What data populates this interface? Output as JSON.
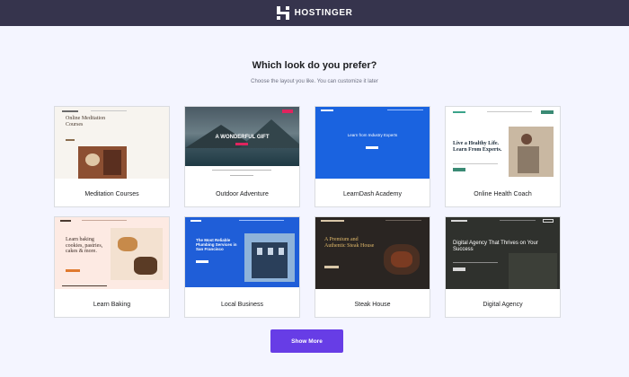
{
  "brand": {
    "name": "HOSTINGER"
  },
  "page": {
    "title": "Which look do you prefer?",
    "subtitle": "Choose the layout you like. You can customize it later"
  },
  "templates": [
    {
      "label": "Meditation Courses",
      "hero": "Online Meditation Courses"
    },
    {
      "label": "Outdoor Adventure",
      "hero": "A WONDERFUL GIFT"
    },
    {
      "label": "LearnDash Academy",
      "hero": "Learn from Industry Experts"
    },
    {
      "label": "Online Health Coach",
      "hero": "Live a Healthy Life. Learn From Experts."
    },
    {
      "label": "Learn Baking",
      "hero": "Learn baking cookies, pastries, cakes & more."
    },
    {
      "label": "Local Business",
      "hero": "The Most Reliable Plumbing Services in San Francisco"
    },
    {
      "label": "Steak House",
      "hero": "A Premium and Authentic Steak House"
    },
    {
      "label": "Digital Agency",
      "hero": "Digital Agency That Thrives on Your Success"
    }
  ],
  "actions": {
    "show_more": "Show More"
  },
  "colors": {
    "topbar": "#36344d",
    "accent": "#673de6",
    "background": "#f4f5ff"
  }
}
